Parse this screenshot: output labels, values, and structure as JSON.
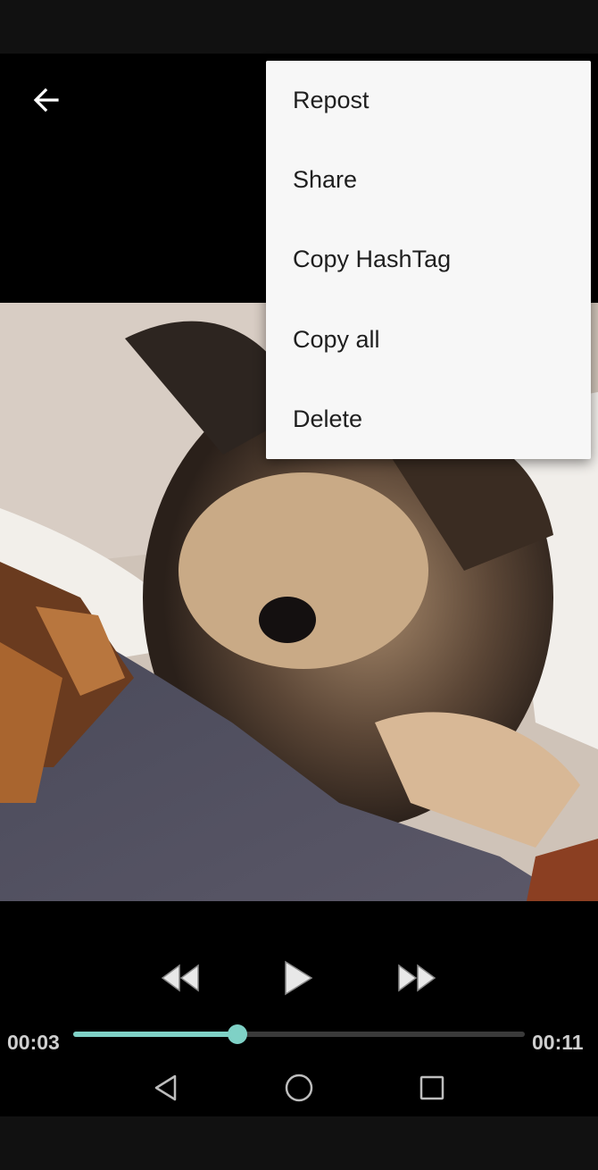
{
  "header": {
    "back_icon": "arrow-left-icon"
  },
  "menu": {
    "items": [
      {
        "label": "Repost"
      },
      {
        "label": "Share"
      },
      {
        "label": "Copy HashTag"
      },
      {
        "label": "Copy all"
      },
      {
        "label": "Delete"
      }
    ]
  },
  "player": {
    "current_time": "00:03",
    "total_time": "00:11",
    "progress": 0.363,
    "accent_color": "#7fd1c6",
    "controls": [
      "rewind-icon",
      "play-icon",
      "fast-forward-icon"
    ]
  },
  "navbar": {
    "buttons": [
      "back-triangle-icon",
      "home-circle-icon",
      "recents-square-icon"
    ]
  }
}
